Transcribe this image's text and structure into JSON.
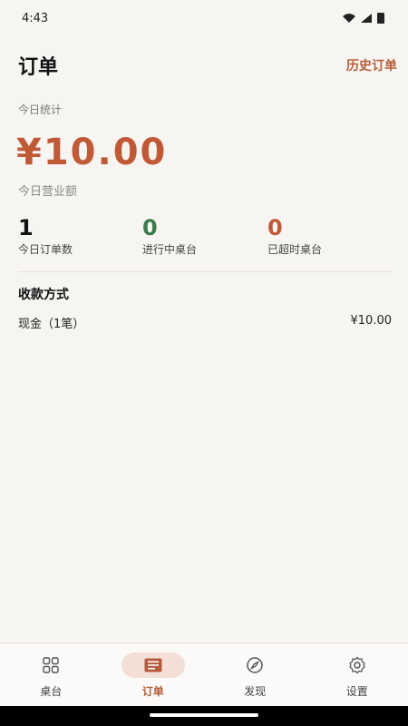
{
  "status": {
    "time": "4:43"
  },
  "header": {
    "title": "订单",
    "history_label": "历史订单"
  },
  "today": {
    "section_label": "今日统计",
    "amount": "¥10.00",
    "amount_label": "今日营业额"
  },
  "stats": [
    {
      "value": "1",
      "label": "今日订单数",
      "color": "#111111"
    },
    {
      "value": "0",
      "label": "进行中桌台",
      "color": "#3c7a4b"
    },
    {
      "value": "0",
      "label": "已超时桌台",
      "color": "#c05a36"
    }
  ],
  "payment": {
    "title": "收款方式",
    "rows": [
      {
        "method": "现金（1笔）",
        "amount": "¥10.00"
      }
    ]
  },
  "nav": {
    "items": [
      {
        "label": "桌台",
        "icon": "grid-icon"
      },
      {
        "label": "订单",
        "icon": "order-list-icon",
        "active": true
      },
      {
        "label": "发现",
        "icon": "compass-icon"
      },
      {
        "label": "设置",
        "icon": "gear-icon"
      }
    ]
  },
  "colors": {
    "accent": "#c05a36",
    "green": "#3c7a4b",
    "background": "#f7f5f2"
  }
}
